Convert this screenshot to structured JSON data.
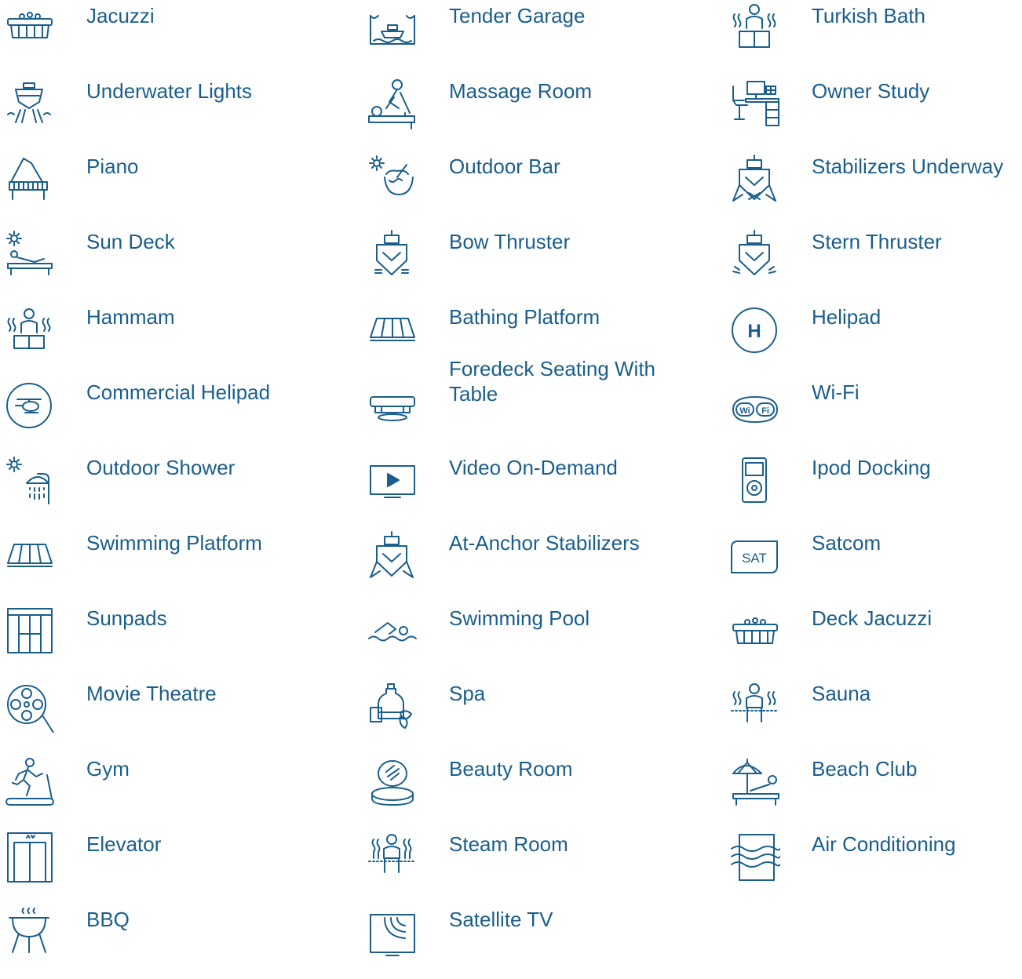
{
  "columns": [
    {
      "items": [
        {
          "label": "Jacuzzi",
          "icon": "jacuzzi-icon"
        },
        {
          "label": "Underwater Lights",
          "icon": "underwater-lights-icon"
        },
        {
          "label": "Piano",
          "icon": "piano-icon"
        },
        {
          "label": "Sun Deck",
          "icon": "sun-deck-icon"
        },
        {
          "label": "Hammam",
          "icon": "hammam-icon"
        },
        {
          "label": "Commercial Helipad",
          "icon": "commercial-helipad-icon"
        },
        {
          "label": "Outdoor Shower",
          "icon": "outdoor-shower-icon"
        },
        {
          "label": "Swimming Platform",
          "icon": "swimming-platform-icon"
        },
        {
          "label": "Sunpads",
          "icon": "sunpads-icon"
        },
        {
          "label": "Movie Theatre",
          "icon": "movie-theatre-icon"
        },
        {
          "label": "Gym",
          "icon": "gym-icon"
        },
        {
          "label": "Elevator",
          "icon": "elevator-icon"
        },
        {
          "label": "BBQ",
          "icon": "bbq-icon"
        }
      ]
    },
    {
      "items": [
        {
          "label": "Tender Garage",
          "icon": "tender-garage-icon"
        },
        {
          "label": "Massage Room",
          "icon": "massage-room-icon"
        },
        {
          "label": "Outdoor Bar",
          "icon": "outdoor-bar-icon"
        },
        {
          "label": "Bow Thruster",
          "icon": "bow-thruster-icon"
        },
        {
          "label": "Bathing Platform",
          "icon": "bathing-platform-icon"
        },
        {
          "label": "Foredeck Seating With Table",
          "icon": "foredeck-seating-icon"
        },
        {
          "label": "Video On-Demand",
          "icon": "video-on-demand-icon"
        },
        {
          "label": "At-Anchor Stabilizers",
          "icon": "at-anchor-stabilizers-icon"
        },
        {
          "label": "Swimming Pool",
          "icon": "swimming-pool-icon"
        },
        {
          "label": "Spa",
          "icon": "spa-icon"
        },
        {
          "label": "Beauty Room",
          "icon": "beauty-room-icon"
        },
        {
          "label": "Steam Room",
          "icon": "steam-room-icon"
        },
        {
          "label": "Satellite TV",
          "icon": "satellite-tv-icon"
        }
      ]
    },
    {
      "items": [
        {
          "label": "Turkish Bath",
          "icon": "turkish-bath-icon"
        },
        {
          "label": "Owner Study",
          "icon": "owner-study-icon"
        },
        {
          "label": "Stabilizers Underway",
          "icon": "stabilizers-underway-icon"
        },
        {
          "label": "Stern Thruster",
          "icon": "stern-thruster-icon"
        },
        {
          "label": "Helipad",
          "icon": "helipad-icon"
        },
        {
          "label": "Wi-Fi",
          "icon": "wifi-icon"
        },
        {
          "label": "Ipod Docking",
          "icon": "ipod-docking-icon"
        },
        {
          "label": "Satcom",
          "icon": "satcom-icon"
        },
        {
          "label": "Deck Jacuzzi",
          "icon": "deck-jacuzzi-icon"
        },
        {
          "label": "Sauna",
          "icon": "sauna-icon"
        },
        {
          "label": "Beach Club",
          "icon": "beach-club-icon"
        },
        {
          "label": "Air Conditioning",
          "icon": "air-conditioning-icon"
        }
      ]
    }
  ],
  "icon_text": {
    "helipad": "H",
    "wifi_left": "Wi",
    "wifi_right": "Fi",
    "satcom": "SAT"
  },
  "colors": {
    "accent": "#1a5e8c"
  }
}
